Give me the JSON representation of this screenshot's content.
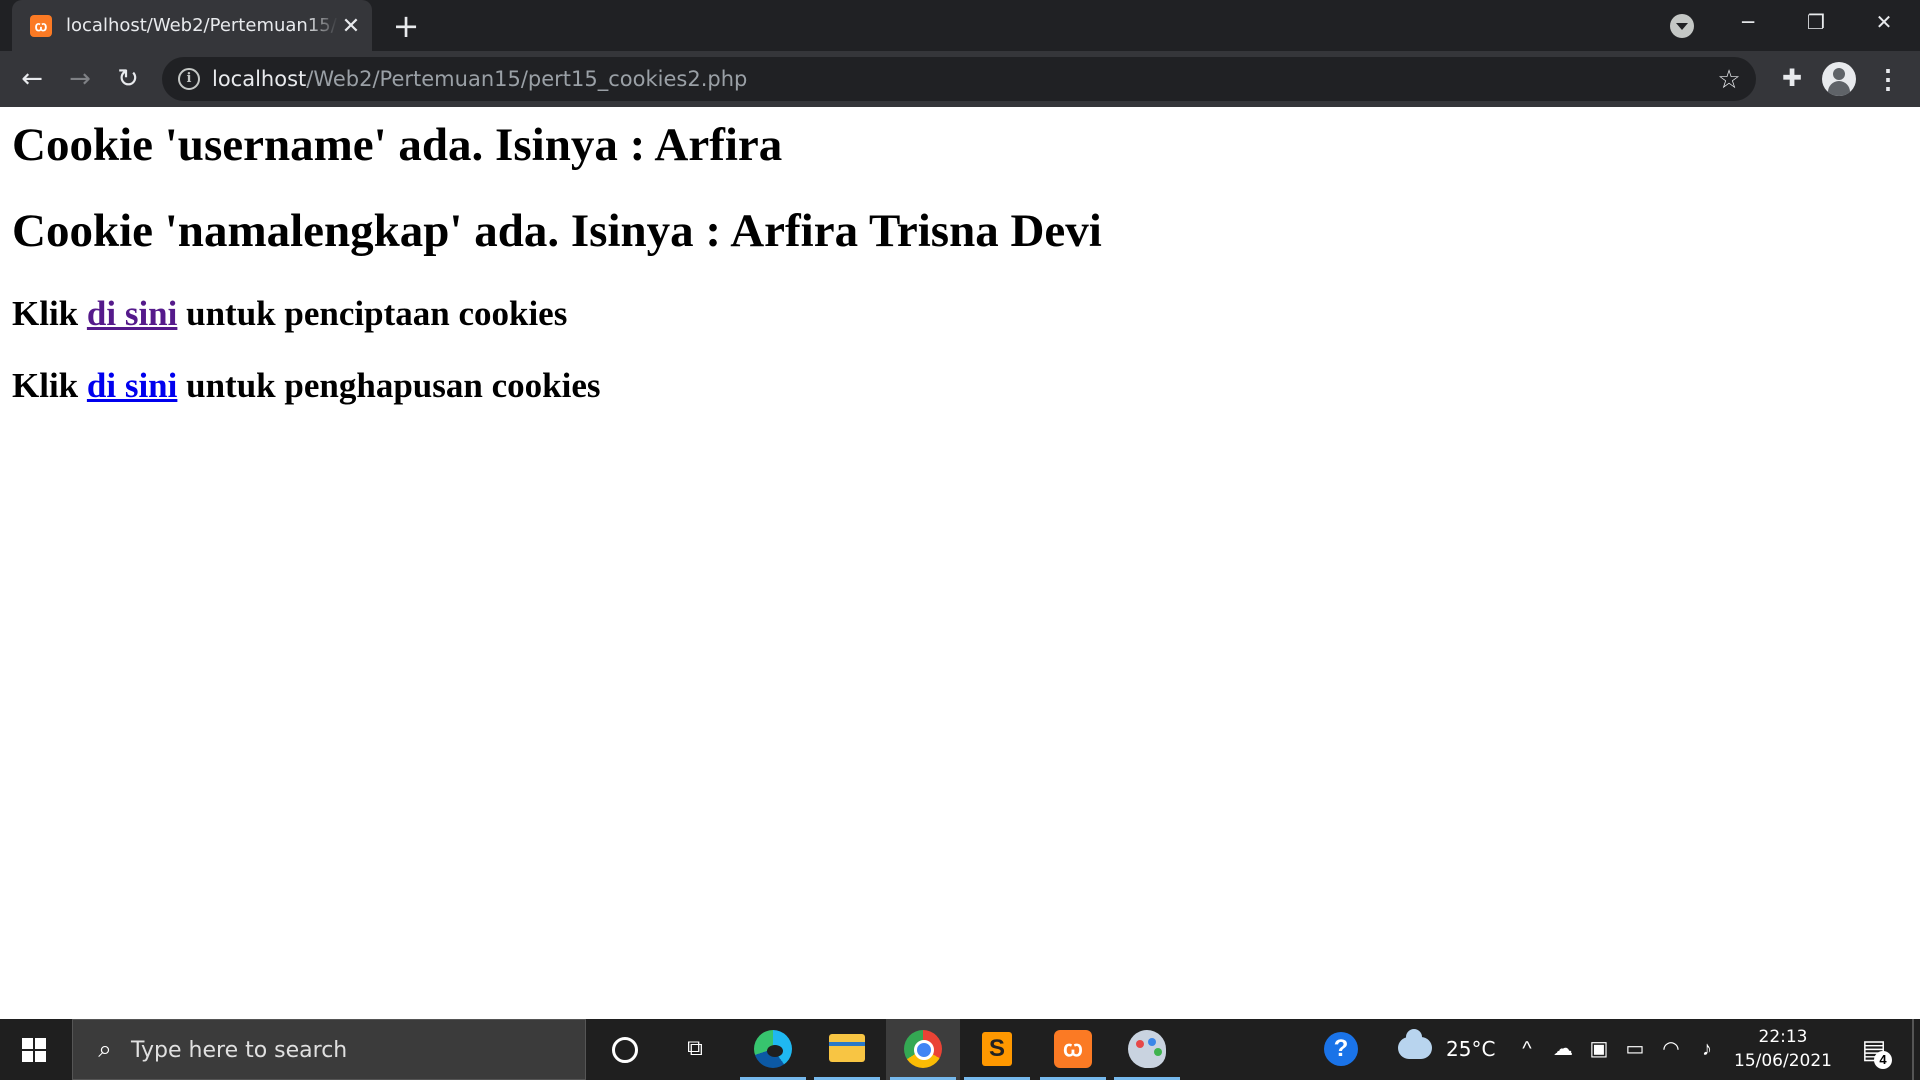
{
  "browser": {
    "tab_title": "localhost/Web2/Pertemuan15/pert15_cookies2.php",
    "tab_close": "✕",
    "new_tab": "+",
    "window_controls": {
      "minimize": "─",
      "restore": "❐",
      "close": "✕"
    },
    "url_host": "localhost",
    "url_path": "/Web2/Pertemuan15/pert15_cookies2.php",
    "icons": [
      "xampp-favicon-icon",
      "tab-search-icon",
      "back-arrow-icon",
      "forward-arrow-icon",
      "reload-icon",
      "info-icon",
      "star-icon",
      "puzzle-extension-icon",
      "profile-avatar",
      "kebab-menu-icon"
    ]
  },
  "page": {
    "heading1": "Cookie 'username' ada. Isinya : Arfira",
    "heading2": "Cookie 'namalengkap' ada. Isinya : Arfira Trisna Devi",
    "line1_prefix": "Klik ",
    "line1_link": "di sini",
    "line1_suffix": " untuk penciptaan cookies",
    "line2_prefix": "Klik ",
    "line2_link": "di sini",
    "line2_suffix": " untuk penghapusan cookies",
    "colors": {
      "visited_link": "#551a8b",
      "link": "#0000ee"
    }
  },
  "taskbar": {
    "search_placeholder": "Type here to search",
    "apps": [
      "cortana-icon",
      "task-view-icon",
      "edge-icon",
      "file-explorer-icon",
      "chrome-icon",
      "sublime-text-icon",
      "xampp-icon",
      "paint-icon"
    ],
    "temperature": "25°C",
    "time": "22:13",
    "date": "15/06/2021",
    "notification_count": "4"
  }
}
